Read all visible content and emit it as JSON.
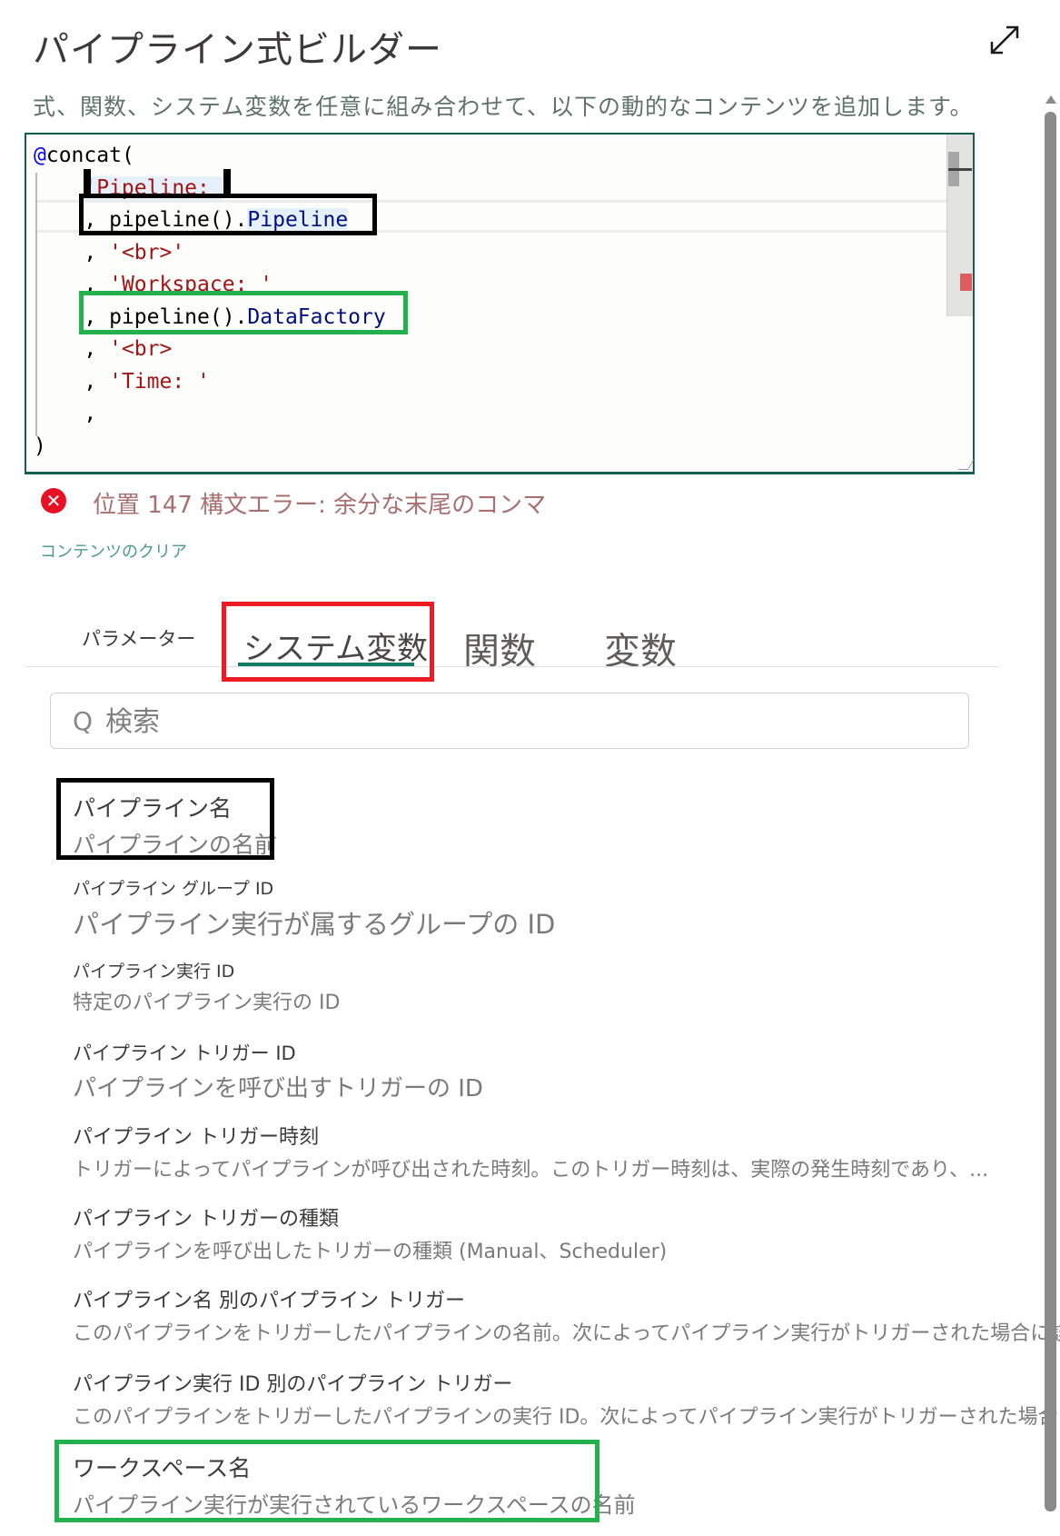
{
  "header": {
    "title": "パイプライン式ビルダー",
    "subtitle": "式、関数、システム変数を任意に組み合わせて、以下の動的なコンテンツを追加します。",
    "expand_icon": "expand-diagonal-icon"
  },
  "editor": {
    "lines": [
      {
        "parts": [
          {
            "t": "@",
            "c": "kw-at"
          },
          {
            "t": "concat(",
            "c": ""
          }
        ]
      },
      {
        "parts": [
          {
            "t": "    ",
            "c": ""
          },
          {
            "t": "'Pipeline: ",
            "c": "str hl"
          },
          {
            "t": "'",
            "c": "str"
          }
        ]
      },
      {
        "parts": [
          {
            "t": "    , pipeline().",
            "c": ""
          },
          {
            "t": "Pipeline",
            "c": "prop hl"
          }
        ]
      },
      {
        "parts": [
          {
            "t": "    , ",
            "c": ""
          },
          {
            "t": "'<br>'",
            "c": "str"
          }
        ]
      },
      {
        "parts": [
          {
            "t": "    , ",
            "c": ""
          },
          {
            "t": "'Workspace: '",
            "c": "str"
          }
        ]
      },
      {
        "parts": [
          {
            "t": "    , pipeline().",
            "c": ""
          },
          {
            "t": "DataFactory",
            "c": "prop"
          }
        ]
      },
      {
        "parts": [
          {
            "t": "    , ",
            "c": ""
          },
          {
            "t": "'<br>",
            "c": "str"
          }
        ]
      },
      {
        "parts": [
          {
            "t": "    , ",
            "c": ""
          },
          {
            "t": "'Time: '",
            "c": "str"
          }
        ]
      },
      {
        "parts": [
          {
            "t": "    ,",
            "c": ""
          }
        ]
      },
      {
        "parts": [
          {
            "t": ")",
            "c": ""
          }
        ]
      }
    ]
  },
  "error": {
    "icon": "error-circle-icon",
    "message": "位置 147 構文エラー: 余分な末尾のコンマ"
  },
  "clear_link": "コンテンツのクリア",
  "tabs": [
    {
      "label": "パラメーター",
      "active": false
    },
    {
      "label": "システム変数",
      "active": true
    },
    {
      "label": "関数",
      "active": false
    },
    {
      "label": "変数",
      "active": false
    }
  ],
  "search": {
    "icon": "search-icon",
    "placeholder": "検索"
  },
  "system_variables": [
    {
      "name": "パイプライン名",
      "description": "パイプラインの名前"
    },
    {
      "name": "パイプライン グループ ID",
      "description": "パイプライン実行が属するグループの ID"
    },
    {
      "name": "パイプライン実行 ID",
      "description": "特定のパイプライン実行の ID"
    },
    {
      "name": "パイプライン トリガー ID",
      "description": "パイプラインを呼び出すトリガーの ID"
    },
    {
      "name": "パイプライン トリガー時刻",
      "description": "トリガーによってパイプラインが呼び出された時刻。このトリガー時刻は、実際の発生時刻であり、..."
    },
    {
      "name": "パイプライン トリガーの種類",
      "description": "パイプラインを呼び出したトリガーの種類 (Manual、Scheduler)"
    },
    {
      "name": "パイプライン名 別のパイプライン トリガー",
      "description": "このパイプラインをトリガーしたパイプラインの名前。次によってパイプライン実行がトリガーされた場合に該当..."
    },
    {
      "name": "パイプライン実行 ID 別のパイプライン トリガー",
      "description": "このパイプラインをトリガーしたパイプラインの実行 ID。次によってパイプライン実行がトリガーされた場合に該当..."
    },
    {
      "name": "ワークスペース名",
      "description": "パイプライン実行が実行されているワークスペースの名前"
    }
  ],
  "colors": {
    "accent": "#127b63",
    "error": "#e81123",
    "annotation_black": "#000000",
    "annotation_green": "#22b14c",
    "annotation_red": "#ed1c24"
  }
}
